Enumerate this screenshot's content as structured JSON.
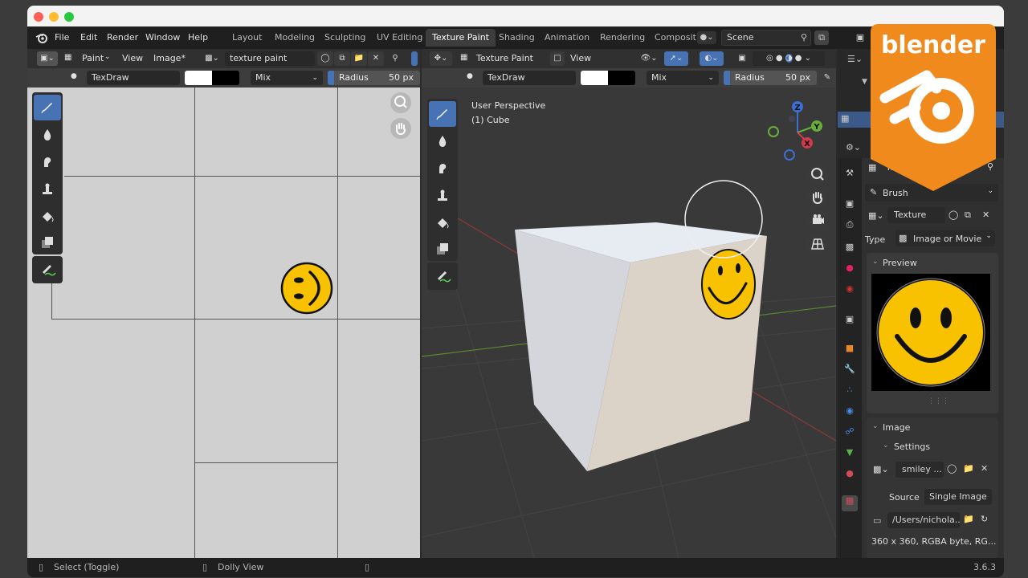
{
  "menu": {
    "items": [
      "File",
      "Edit",
      "Render",
      "Window",
      "Help"
    ]
  },
  "workspaces": {
    "tabs": [
      "Layout",
      "Modeling",
      "Sculpting",
      "UV Editing",
      "Texture Paint",
      "Shading",
      "Animation",
      "Rendering",
      "Compositi"
    ],
    "active": "Texture Paint"
  },
  "scene": {
    "name": "Scene"
  },
  "image_editor": {
    "header": {
      "mode": "Paint",
      "view_menu": "View",
      "image_menu": "Image*",
      "image_name": "texture paint image"
    },
    "tool_settings": {
      "brush": "TexDraw",
      "blend": "Mix",
      "radius_label": "Radius",
      "radius_value": "50 px"
    }
  },
  "viewport": {
    "header": {
      "mode": "Texture Paint",
      "view_menu": "View"
    },
    "tool_settings": {
      "brush": "TexDraw",
      "blend": "Mix",
      "radius_label": "Radius",
      "radius_value": "50 px"
    },
    "overlay_title": "User Perspective",
    "overlay_object": "(1) Cube",
    "gizmo": {
      "z": "Z",
      "y": "Y",
      "x": "X"
    }
  },
  "properties": {
    "texture_name_cut": "Textu",
    "brush_label": "Brush",
    "texture_field": "Texture",
    "type_label": "Type",
    "type_value": "Image or Movie",
    "preview_title": "Preview",
    "image_title": "Image",
    "settings_title": "Settings",
    "image_name": "smiley ...",
    "source_label": "Source",
    "source_value": "Single Image",
    "filepath": "/Users/nichola...",
    "image_info": "360 x 360,  RGBA byte,  RG..."
  },
  "statusbar": {
    "left": "Select (Toggle)",
    "middle": "Dolly View",
    "version": "3.6.3"
  },
  "badge": {
    "text": "blender"
  },
  "colors": {
    "accent": "#4772b3",
    "badge": "#f08a1d",
    "smiley": "#f8c200"
  }
}
